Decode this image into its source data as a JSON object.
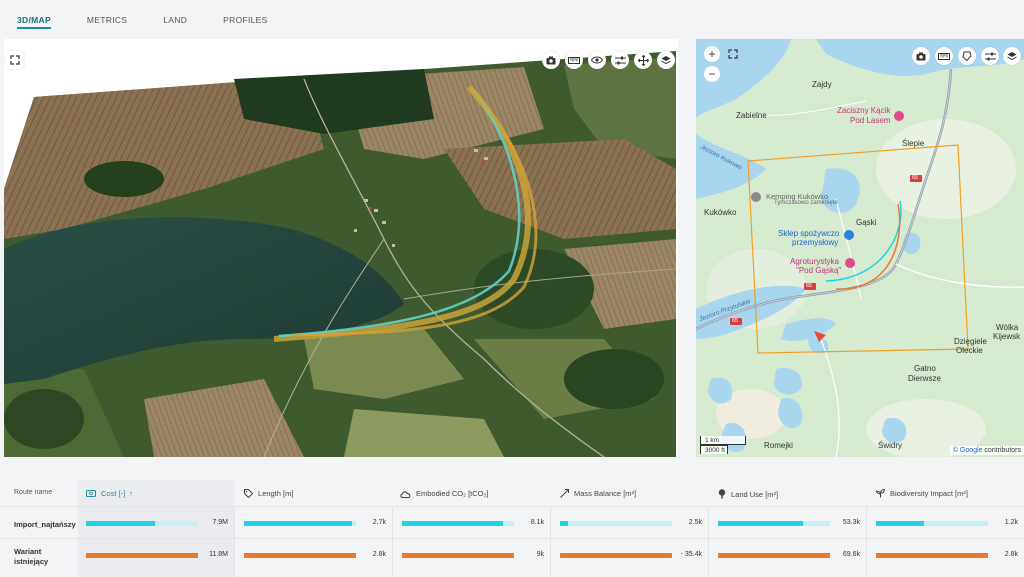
{
  "tabs": [
    {
      "label": "3D/MAP",
      "active": true
    },
    {
      "label": "METRICS",
      "active": false
    },
    {
      "label": "LAND",
      "active": false
    },
    {
      "label": "PROFILES",
      "active": false
    }
  ],
  "map3d": {
    "toolbar": [
      "camera-icon",
      "ruler-icon",
      "eye-icon",
      "sliders-icon",
      "move-icon",
      "layers-icon"
    ],
    "fullscreen_icon": "expand-icon"
  },
  "map2d": {
    "toolbar": [
      "camera-icon",
      "ruler-icon",
      "shape-icon",
      "sliders-icon",
      "layers-icon"
    ],
    "zoom_in": "+",
    "zoom_out": "−",
    "labels": {
      "zajdy": "Zajdy",
      "zabielne": "Zabielne",
      "zaciszny1": "Zaciszny Kącik",
      "zaciszny2": "Pod Lasem",
      "slepie": "Ślepie",
      "jezioro_kukowo": "Jezioro Kukowo",
      "kemping1": "Kemping Kukówko",
      "kemping2": "Tymczasowo zamknięte",
      "kukowko": "Kukówko",
      "gaski": "Gąski",
      "sklep1": "Sklep spożywczo",
      "sklep2": "przemysłowy",
      "agro1": "Agroturystyka",
      "agro2": "\"Pod Gąską\"",
      "jezioro_przytulskie": "Jezioro Przytulskie",
      "dzieglele1": "Dzięgiele",
      "dzieglele2": "Oleckie",
      "wolka1": "Wólka",
      "wolka2": "Kijewsk",
      "gatno1": "Gatno",
      "gatno2": "Dierwsze",
      "romejki": "Romejki",
      "swidry": "Świdry",
      "road65a": "65",
      "road65b": "65",
      "road65c": "65"
    },
    "scale_km": "1 km",
    "scale_ft": "3000 ft",
    "attribution_google": "© Google",
    "attribution_rest": "contributors"
  },
  "table": {
    "route_header": "Route name",
    "columns": [
      {
        "label": "Cost [-]",
        "icon": "money-icon",
        "sort": "↑"
      },
      {
        "label": "Length [m]",
        "icon": "tag-icon"
      },
      {
        "label": "Embodied CO₂ [tCO₂]",
        "icon": "cloud-icon"
      },
      {
        "label": "Mass Balance [m³]",
        "icon": "trend-icon"
      },
      {
        "label": "Land Use [m²]",
        "icon": "tree-icon"
      },
      {
        "label": "Biodiversity Impact [m²]",
        "icon": "sprout-icon"
      }
    ],
    "rows": [
      {
        "name": "Import_najtańszy",
        "color": "#22d3e6",
        "values": [
          "7.9M",
          "2.7k",
          "8.1k",
          "2.5k",
          "53.3k",
          "1.2k"
        ],
        "fractions": [
          0.62,
          0.96,
          0.9,
          0.07,
          0.76,
          0.43
        ]
      },
      {
        "name": "Wariant istniejący",
        "color": "#e87a2e",
        "values": [
          "11.8M",
          "2.8k",
          "9k",
          "- 35.4k",
          "69.6k",
          "2.8k"
        ],
        "fractions": [
          1.0,
          1.0,
          1.0,
          1.0,
          1.0,
          1.0
        ]
      }
    ]
  }
}
